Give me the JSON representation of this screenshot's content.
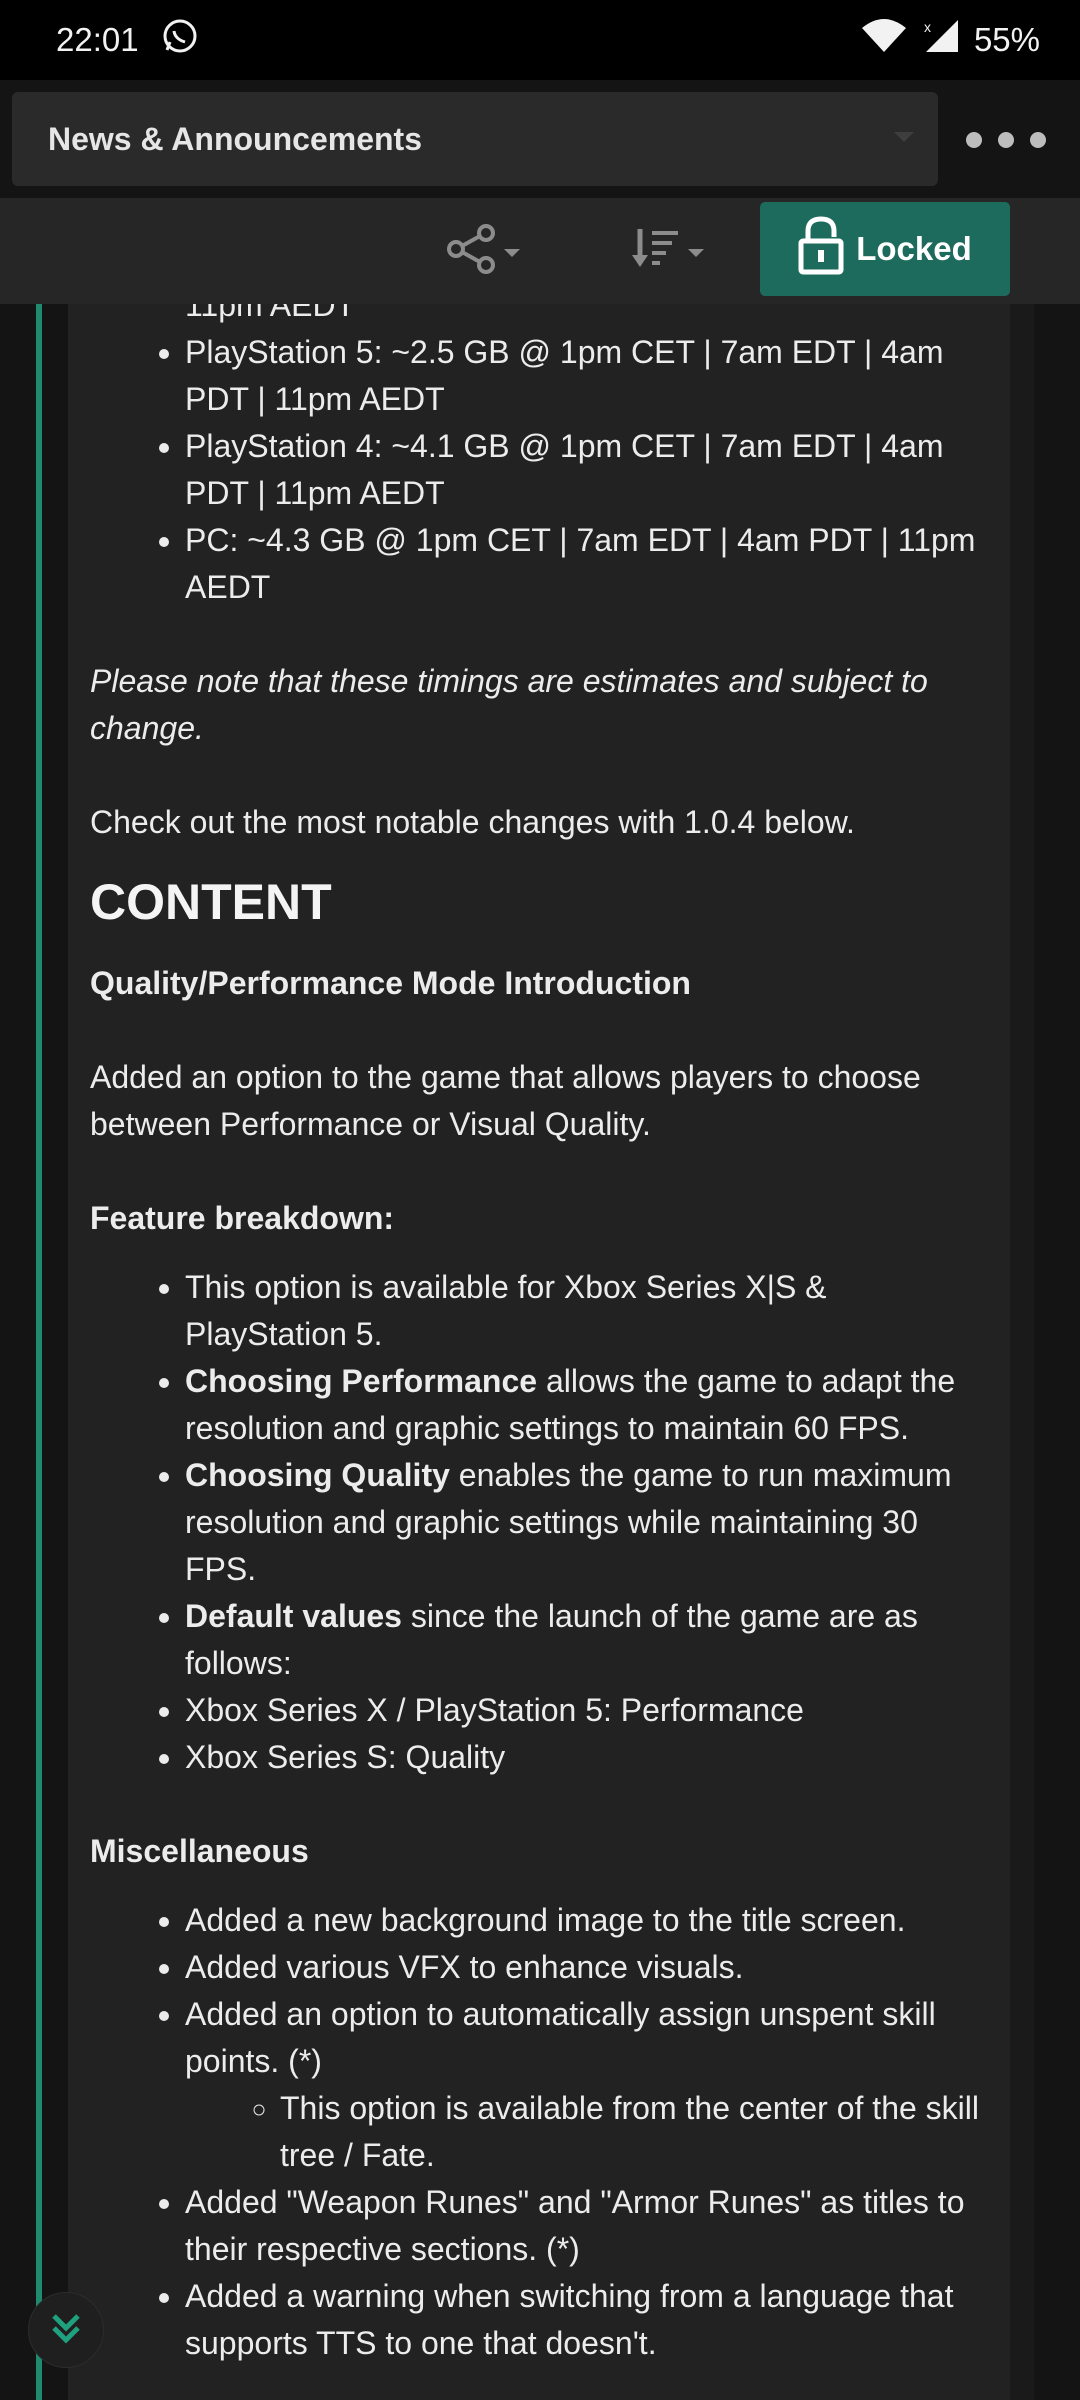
{
  "status_bar": {
    "time": "22:01",
    "battery": "55%",
    "icons": [
      "whatsapp-icon",
      "wifi-icon",
      "cell-signal-icon"
    ]
  },
  "header": {
    "forum_title": "News & Announcements",
    "more_icon": "more-dots-icon"
  },
  "toolbar": {
    "share_icon": "share-icon",
    "sort_icon": "sort-icon",
    "locked_label": "Locked",
    "lock_icon": "lock-icon"
  },
  "post": {
    "top_partial": "11pm AEDT",
    "downloads": [
      "PlayStation 5: ~2.5 GB @ 1pm CET | 7am EDT | 4am PDT | 11pm AEDT",
      "PlayStation 4: ~4.1 GB @ 1pm CET | 7am EDT | 4am PDT | 11pm AEDT",
      "PC: ~4.3 GB @ 1pm CET | 7am EDT | 4am PDT | 11pm AEDT"
    ],
    "note": "Please note that these timings are estimates and subject to change.",
    "intro": "Check out the most notable changes with 1.0.4 below.",
    "section_heading": "CONTENT",
    "subheading_1": "Quality/Performance Mode Introduction",
    "paragraph_1": "Added an option to the game that allows players to choose between Performance or Visual Quality.",
    "subheading_2": "Feature breakdown:",
    "feature_item_1": "This option is available for Xbox Series X|S & PlayStation 5.",
    "feature_item_2_bold": "Choosing Performance",
    "feature_item_2_rest": " allows the game to adapt the resolution and graphic settings to maintain 60 FPS.",
    "feature_item_3_bold": "Choosing Quality",
    "feature_item_3_rest": " enables the game to run maximum resolution and graphic settings while maintaining 30 FPS.",
    "feature_item_4_bold": "Default values",
    "feature_item_4_rest": " since the launch of the game are as follows:",
    "feature_item_5": "Xbox Series X / PlayStation 5: Performance",
    "feature_item_6": "Xbox Series S: Quality",
    "subheading_3": "Miscellaneous",
    "misc_item_1": "Added a new background image to the title screen.",
    "misc_item_2": "Added various VFX to enhance visuals.",
    "misc_item_3": "Added an option to automatically assign unspent skill points. (*)",
    "misc_sub_item_1": "This option is available from the center of the skill tree / Fate.",
    "misc_item_4": "Added \"Weapon Runes\" and \"Armor Runes\" as titles to their respective sections. (*)",
    "misc_item_5": "Added a warning when switching from a language that supports TTS to one that doesn't."
  },
  "scroll_button_icon": "double-chevron-down-icon"
}
